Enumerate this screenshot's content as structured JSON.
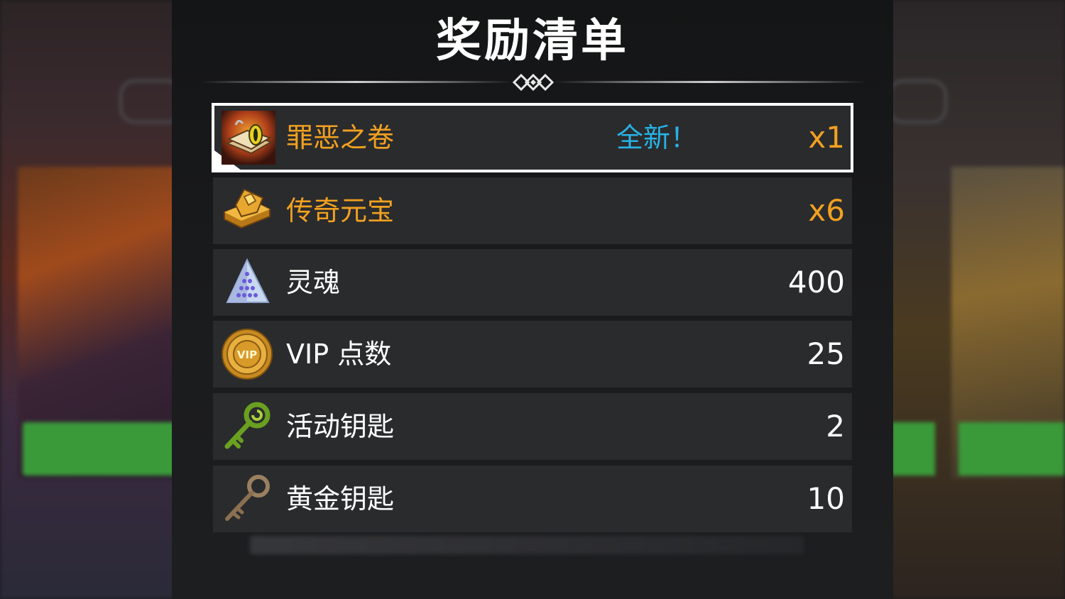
{
  "dialog": {
    "title": "奖励清单"
  },
  "rewards": [
    {
      "name": "罪恶之卷",
      "tag": "全新！",
      "quantity": "x1",
      "icon": "book-of-sin-icon",
      "name_color": "#f2a120",
      "highlighted": true
    },
    {
      "name": "传奇元宝",
      "tag": "",
      "quantity": "x6",
      "icon": "legendary-ingot-icon",
      "name_color": "#f2a120",
      "highlighted": false
    },
    {
      "name": "灵魂",
      "tag": "",
      "quantity": "400",
      "icon": "soul-crystal-icon",
      "name_color": "#ffffff",
      "highlighted": false
    },
    {
      "name": "VIP 点数",
      "tag": "",
      "quantity": "25",
      "icon": "vip-coin-icon",
      "name_color": "#ffffff",
      "highlighted": false
    },
    {
      "name": "活动钥匙",
      "tag": "",
      "quantity": "2",
      "icon": "event-key-icon",
      "name_color": "#ffffff",
      "highlighted": false
    },
    {
      "name": "黄金钥匙",
      "tag": "",
      "quantity": "10",
      "icon": "gold-key-icon",
      "name_color": "#ffffff",
      "highlighted": false
    }
  ],
  "colors": {
    "gold_text": "#f2a120",
    "new_tag": "#27b3e6",
    "row_background": "#2a2b2d",
    "highlight_border": "#ffffff"
  }
}
